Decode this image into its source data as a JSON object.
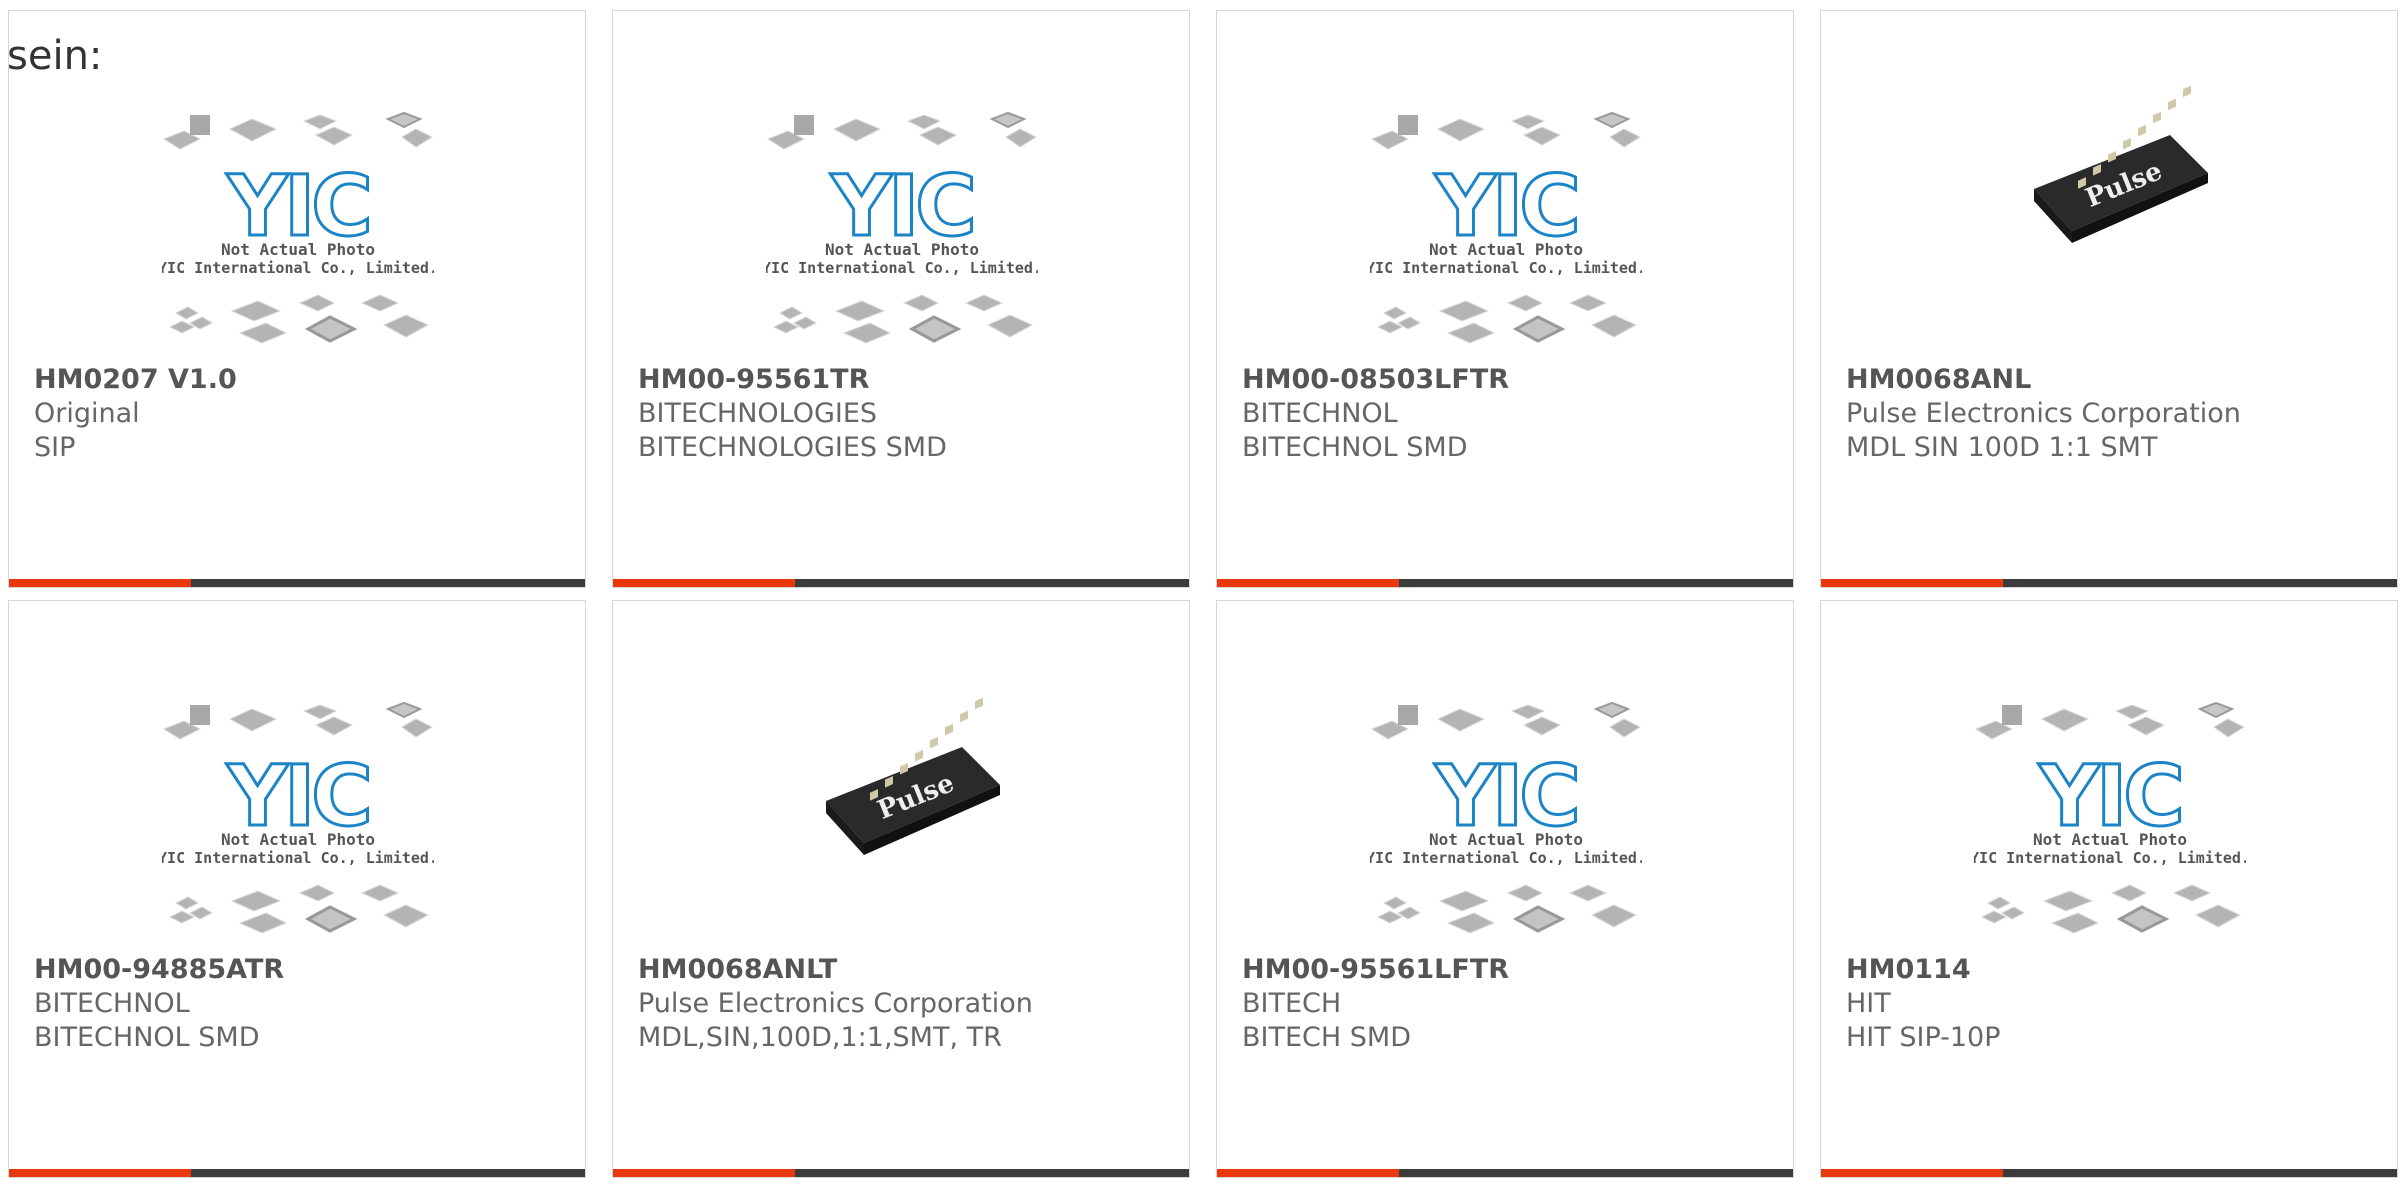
{
  "lead_text": "sein:",
  "colors": {
    "accent": "#e8380d",
    "bar": "#3c3c3c",
    "border": "#d6d6d6",
    "text": "#666666",
    "yic_blue": "#1b84c6"
  },
  "placeholder": {
    "line1": "Not Actual Photo",
    "line2": "YIC International Co., Limited.",
    "logo": "YIC"
  },
  "products": [
    {
      "part": "HM0207 V1.0",
      "maker": "Original",
      "desc": "SIP",
      "image": "yic-placeholder"
    },
    {
      "part": "HM00-95561TR",
      "maker": "BITECHNOLOGIES",
      "desc": "BITECHNOLOGIES SMD",
      "image": "yic-placeholder"
    },
    {
      "part": "HM00-08503LFTR",
      "maker": "BITECHNOL",
      "desc": "BITECHNOL SMD",
      "image": "yic-placeholder"
    },
    {
      "part": "HM0068ANL",
      "maker": "Pulse Electronics Corporation",
      "desc": "MDL SIN 100D 1:1 SMT",
      "image": "pulse-chip",
      "chip_label": "Pulse"
    },
    {
      "part": "HM00-94885ATR",
      "maker": "BITECHNOL",
      "desc": "BITECHNOL SMD",
      "image": "yic-placeholder"
    },
    {
      "part": "HM0068ANLT",
      "maker": "Pulse Electronics Corporation",
      "desc": "MDL,SIN,100D,1:1,SMT, TR",
      "image": "pulse-chip",
      "chip_label": "Pulse"
    },
    {
      "part": "HM00-95561LFTR",
      "maker": "BITECH",
      "desc": "BITECH SMD",
      "image": "yic-placeholder"
    },
    {
      "part": "HM0114",
      "maker": "HIT",
      "desc": "HIT SIP-10P",
      "image": "yic-placeholder"
    }
  ]
}
